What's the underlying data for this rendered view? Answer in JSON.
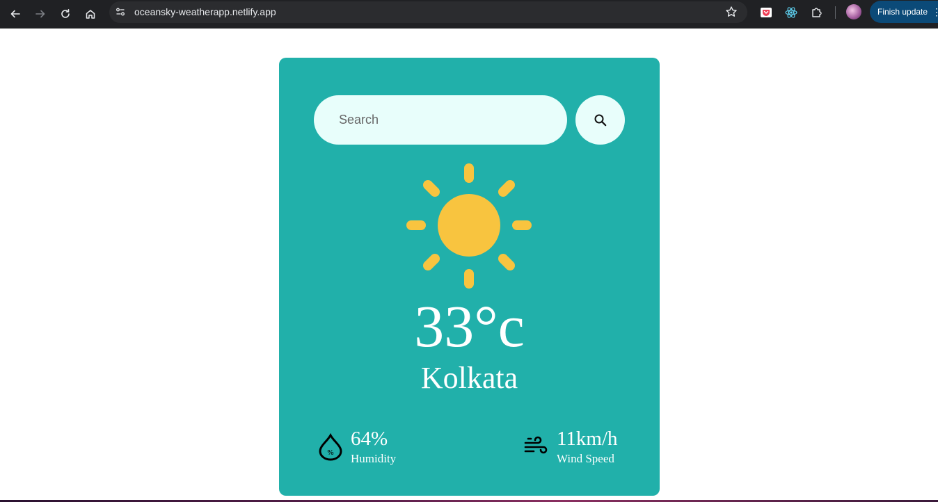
{
  "browser": {
    "url": "oceansky-weatherapp.netlify.app",
    "finish_update_label": "Finish update",
    "icons": {
      "back": "arrow-left-icon",
      "forward": "arrow-right-icon",
      "reload": "reload-icon",
      "home": "home-icon",
      "site_info": "tune-icon",
      "bookmark": "star-icon",
      "pocket": "pocket-extension-icon",
      "react": "react-devtools-icon",
      "extensions": "puzzle-icon",
      "menu": "more-vert-icon"
    }
  },
  "weather": {
    "search_placeholder": "Search",
    "search_value": "",
    "temperature": "33°c",
    "city": "Kolkata",
    "humidity_value": "64%",
    "humidity_label": "Humidity",
    "wind_value": "11km/h",
    "wind_label": "Wind Speed",
    "condition_icon": "sun-icon",
    "colors": {
      "card": "#21b0aa",
      "input": "#e8fefb",
      "sun": "#f8c43f",
      "text": "#ffffff"
    }
  }
}
